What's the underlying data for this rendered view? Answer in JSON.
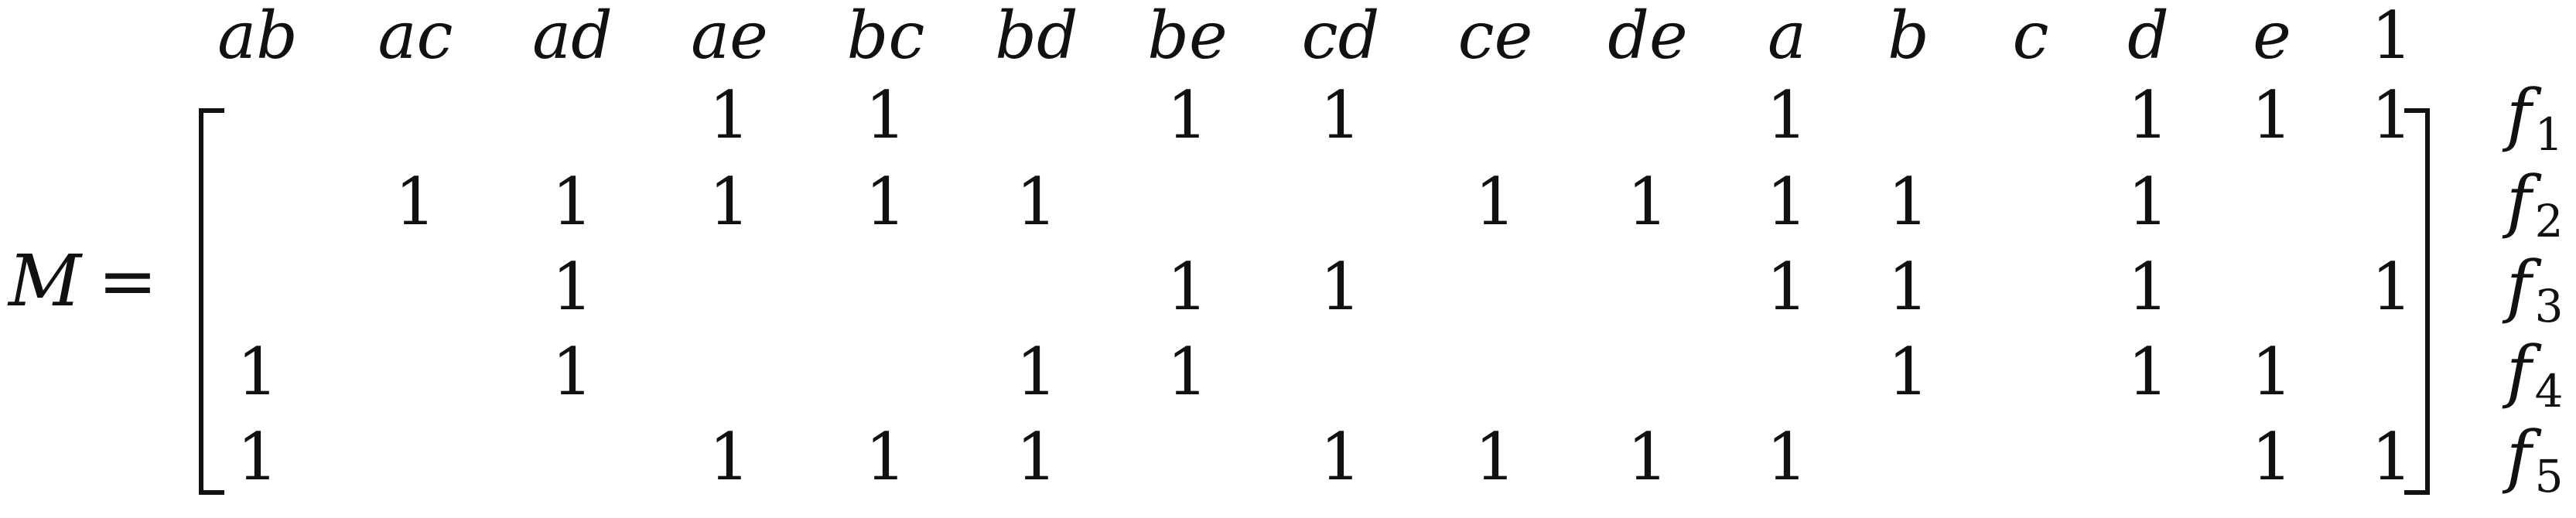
{
  "matrix": {
    "symbol": "M",
    "equals": "=",
    "column_labels": [
      "ab",
      "ac",
      "ad",
      "ae",
      "bc",
      "bd",
      "be",
      "cd",
      "ce",
      "de",
      "a",
      "b",
      "c",
      "d",
      "e",
      "1"
    ],
    "rows": [
      {
        "name": "f",
        "subscript": "1",
        "cells": [
          "",
          "",
          "",
          "1",
          "1",
          "",
          "1",
          "1",
          "",
          "",
          "1",
          "",
          "",
          "1",
          "1",
          "1"
        ]
      },
      {
        "name": "f",
        "subscript": "2",
        "cells": [
          "",
          "1",
          "1",
          "1",
          "1",
          "1",
          "",
          "",
          "1",
          "1",
          "1",
          "1",
          "",
          "1",
          "",
          ""
        ]
      },
      {
        "name": "f",
        "subscript": "3",
        "cells": [
          "",
          "",
          "1",
          "",
          "",
          "",
          "1",
          "1",
          "",
          "",
          "1",
          "1",
          "",
          "1",
          "",
          "1"
        ]
      },
      {
        "name": "f",
        "subscript": "4",
        "cells": [
          "1",
          "",
          "1",
          "",
          "",
          "1",
          "1",
          "",
          "",
          "",
          "",
          "1",
          "",
          "1",
          "1",
          ""
        ]
      },
      {
        "name": "f",
        "subscript": "5",
        "cells": [
          "1",
          "",
          "",
          "1",
          "1",
          "1",
          "",
          "1",
          "1",
          "1",
          "1",
          "",
          "",
          "",
          "1",
          "1"
        ]
      }
    ]
  }
}
